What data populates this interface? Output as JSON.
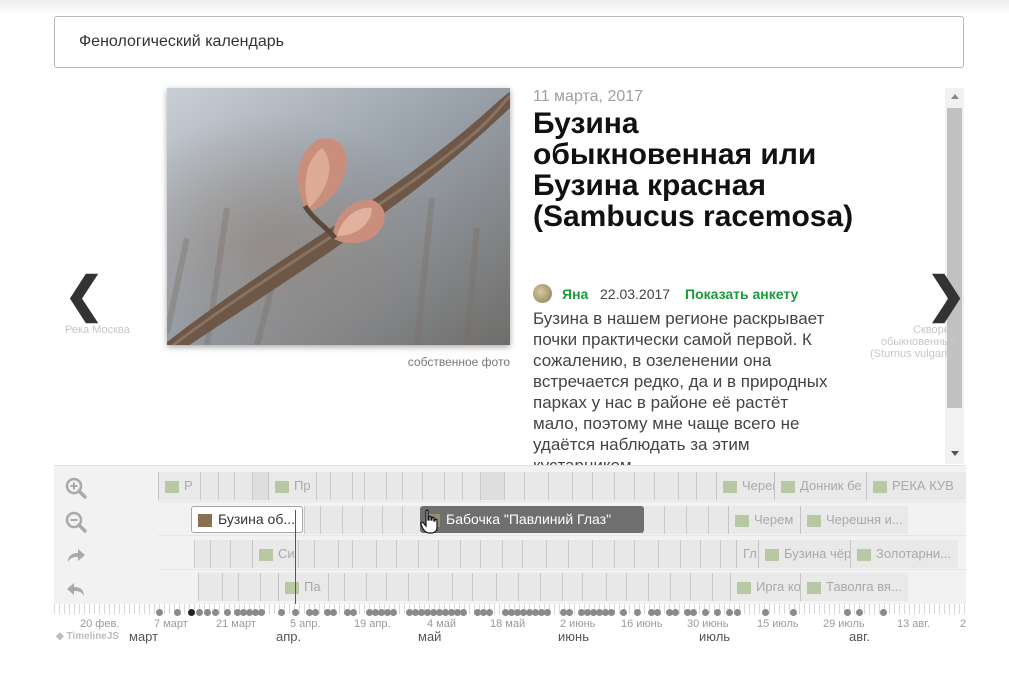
{
  "page": {
    "title": "Фенологический календарь"
  },
  "slide": {
    "date": "11 марта, 2017",
    "title": "Бузина обыкновенная или Бузина красная (Sambucus racemosa)",
    "photo_caption": "собственное фото",
    "author": "Яна",
    "post_date": "22.03.2017",
    "profile_link": "Показать анкету",
    "description": "Бузина в нашем регионе раскрывает почки практически самой первой. К сожалению, в озеленении она встречается редко, да и в природных парках у нас в районе её растёт мало, поэтому мне чаще всего не удаётся наблюдать за этим кустарником"
  },
  "nav": {
    "prev_arrow": "❮",
    "prev_label": "Река Москва",
    "next_arrow": "❯",
    "next_label": "Скворец обыкновенный (Sturnus vulgaris)"
  },
  "tools": {
    "zoom_in": "zoom-in-icon",
    "zoom_out": "zoom-out-icon",
    "redo": "redo-icon",
    "back": "back-icon"
  },
  "timeline": {
    "row1": [
      "Р",
      "Пр",
      "Черец",
      "Донник бе",
      "РЕКА КУВ"
    ],
    "row2": [
      "Бузина об...",
      "Бабочка \"Павлиний Глаз\"",
      "Черем",
      "Черешня и..."
    ],
    "row3": [
      "Си",
      "Гл",
      "Бузина чёр...",
      "Золотарни..."
    ],
    "row4": [
      "Па",
      "Ирга коло",
      "Таволга вя..."
    ],
    "minor_ticks": [
      "20 фев.",
      "7 март",
      "21 март",
      "5 апр.",
      "19 апр.",
      "4 май",
      "18 май",
      "2 июнь",
      "16 июнь",
      "30 июнь",
      "15 июль",
      "29 июль",
      "13 авг.",
      "2"
    ],
    "major_ticks": [
      "март",
      "апр.",
      "май",
      "июнь",
      "июль",
      "авг."
    ],
    "brand": "TimelineJS"
  },
  "colors": {
    "accent_green": "#1a9a3a",
    "title": "#111111",
    "hover_marker": "#6f6f6f"
  }
}
